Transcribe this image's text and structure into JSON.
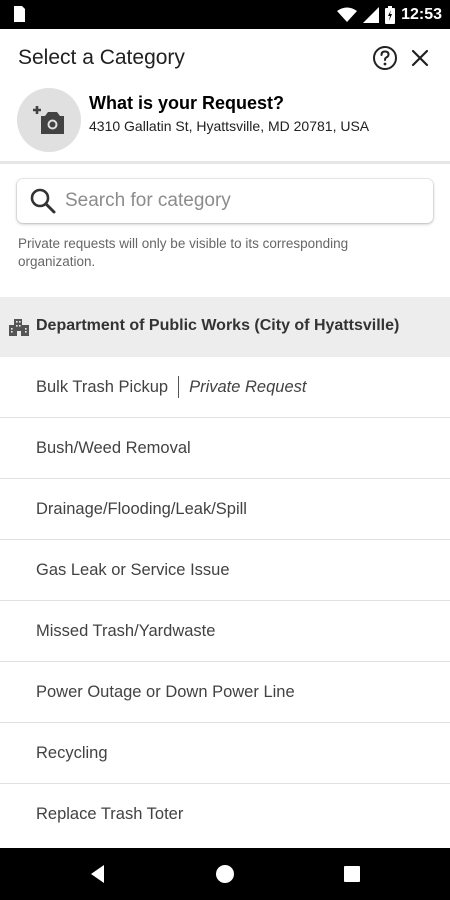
{
  "status_bar": {
    "time": "12:53",
    "icons": [
      "sim-card-icon",
      "wifi-icon",
      "signal-icon",
      "battery-icon"
    ]
  },
  "header": {
    "title": "Select a Category",
    "icons": [
      "help-icon",
      "close-icon"
    ]
  },
  "request": {
    "title": "What is your Request?",
    "address": "4310 Gallatin St, Hyattsville, MD 20781, USA",
    "icon": "add-photo-icon"
  },
  "search": {
    "placeholder": "Search for category",
    "value": ""
  },
  "private_note": "Private requests will only be visible to its corresponding organization.",
  "department": {
    "label": "Department of Public Works (City of Hyattsville)",
    "icon": "building-icon"
  },
  "categories": [
    {
      "label": "Bulk Trash Pickup",
      "tag": "Private Request"
    },
    {
      "label": "Bush/Weed Removal"
    },
    {
      "label": "Drainage/Flooding/Leak/Spill"
    },
    {
      "label": "Gas Leak or Service Issue"
    },
    {
      "label": "Missed Trash/Yardwaste"
    },
    {
      "label": "Power Outage or Down Power Line"
    },
    {
      "label": "Recycling"
    },
    {
      "label": "Replace Trash Toter"
    }
  ],
  "nav_bar": {
    "icons": [
      "back-icon",
      "home-icon",
      "recents-icon"
    ]
  },
  "colors": {
    "status_bar_bg": "#000000",
    "section_header_bg": "#ededed",
    "avatar_bg": "#e0e0e0"
  }
}
